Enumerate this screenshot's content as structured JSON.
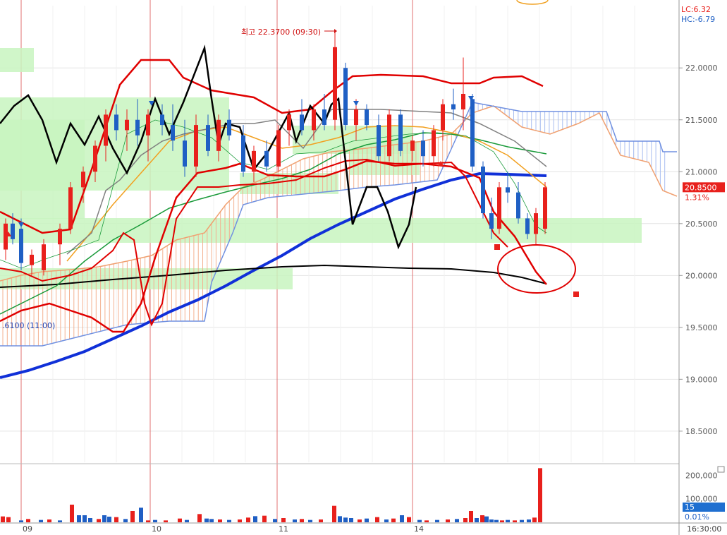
{
  "header": {
    "lc_label": "LC:6.32",
    "hc_label": "HC:-6.79",
    "high_annotation": "최고 22.3700 (09:30)",
    "low_annotation": ".6100 (11:00)"
  },
  "colors": {
    "up": "#e8201c",
    "down": "#1f5fc4",
    "ma_long": "#1030d8",
    "envelope": "#e00000",
    "black_line": "#000000",
    "orange_line": "#f2a020",
    "green_line": "#1a9a3a",
    "span_a": "#f0a070",
    "span_b": "#7090e0",
    "highlight": "#c8f5c0"
  },
  "chart_data": {
    "type": "candlestick",
    "title": "",
    "ylim": [
      18.2,
      22.6
    ],
    "yticks": [
      "22.0000",
      "21.5000",
      "21.0000",
      "20.5000",
      "20.0000",
      "19.5000",
      "19.0000",
      "18.5000"
    ],
    "ytick_values": [
      22.0,
      21.5,
      21.0,
      20.5,
      20.0,
      19.5,
      19.0,
      18.5
    ],
    "xticks": [
      "09",
      "10",
      "11",
      "14"
    ],
    "time_label": "16:30:00",
    "last_price": "20.8500",
    "last_change": "1.31%",
    "candles_sample": [
      {
        "o": 20.1,
        "h": 20.6,
        "l": 20.0,
        "c": 20.5
      },
      {
        "o": 20.5,
        "h": 21.0,
        "l": 20.4,
        "c": 20.9
      },
      {
        "o": 21.4,
        "h": 21.7,
        "l": 21.1,
        "c": 21.6
      },
      {
        "o": 21.5,
        "h": 21.8,
        "l": 21.0,
        "c": 21.2
      },
      {
        "o": 21.3,
        "h": 21.6,
        "l": 21.0,
        "c": 21.5
      },
      {
        "o": 21.5,
        "h": 22.37,
        "l": 21.4,
        "c": 22.2
      },
      {
        "o": 21.9,
        "h": 22.0,
        "l": 21.3,
        "c": 21.4
      },
      {
        "o": 21.4,
        "h": 21.6,
        "l": 21.1,
        "c": 21.2
      },
      {
        "o": 21.3,
        "h": 21.8,
        "l": 21.1,
        "c": 21.7
      },
      {
        "o": 21.6,
        "h": 22.1,
        "l": 20.3,
        "c": 20.6
      },
      {
        "o": 20.6,
        "h": 20.9,
        "l": 20.3,
        "c": 20.5
      },
      {
        "o": 20.4,
        "h": 20.9,
        "l": 20.35,
        "c": 20.85
      }
    ],
    "volume": {
      "yticks": [
        "200,000",
        "100,000"
      ],
      "ytick_values": [
        200000,
        100000
      ],
      "ylim": [
        0,
        240000
      ],
      "last_volume": "15",
      "last_volume_change": "0.01%",
      "bars_sample": [
        {
          "v": 30000,
          "up": true
        },
        {
          "v": 60000,
          "up": false
        },
        {
          "v": 120000,
          "up": true
        },
        {
          "v": 50000,
          "up": false
        },
        {
          "v": 90000,
          "up": true
        },
        {
          "v": 40000,
          "up": false
        },
        {
          "v": 150000,
          "up": true
        },
        {
          "v": 70000,
          "up": false
        },
        {
          "v": 30000,
          "up": true
        },
        {
          "v": 110000,
          "up": true
        },
        {
          "v": 45000,
          "up": false
        },
        {
          "v": 230000,
          "up": true
        }
      ]
    }
  }
}
